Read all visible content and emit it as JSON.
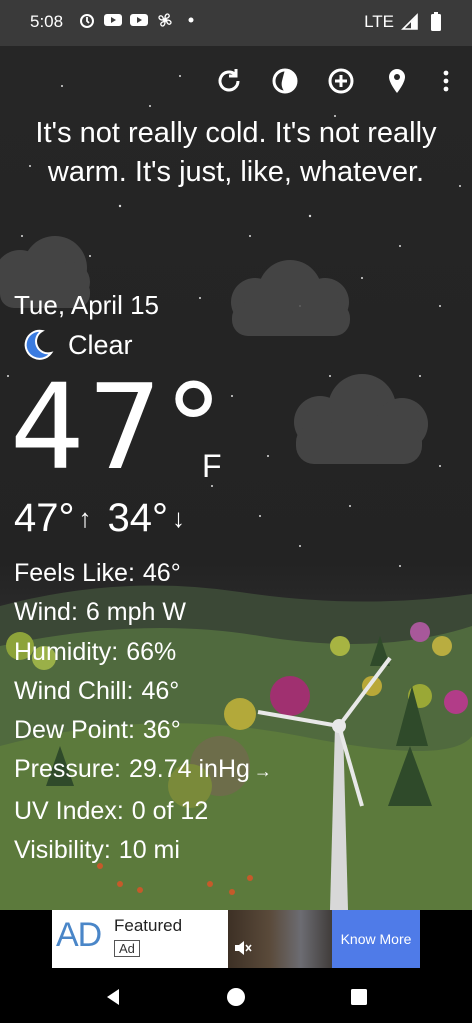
{
  "status_bar": {
    "time": "5:08",
    "network": "LTE",
    "icons": [
      "alarm-icon",
      "youtube-icon",
      "youtube-icon",
      "fan-icon",
      "dot-icon",
      "signal-icon",
      "battery-icon"
    ]
  },
  "toolbar": {
    "buttons": [
      "refresh-icon",
      "radar-icon",
      "add-location-icon",
      "location-pin-icon",
      "more-vert-icon"
    ]
  },
  "tagline": "It's not really cold. It's not really warm. It's just, like, whatever.",
  "weather": {
    "date": "Tue, April 15",
    "condition": "Clear",
    "condition_icon": "moon-icon",
    "temperature": "47°",
    "unit": "F",
    "high": "47°",
    "low": "34°"
  },
  "details": [
    {
      "label": "Feels Like:",
      "value": "46°"
    },
    {
      "label": "Wind:",
      "value": "6 mph W"
    },
    {
      "label": "Humidity:",
      "value": "66%"
    },
    {
      "label": "Wind Chill:",
      "value": "46°"
    },
    {
      "label": "Dew Point:",
      "value": "36°"
    },
    {
      "label": "Pressure:",
      "value": "29.74 inHg"
    },
    {
      "label": "UV Index:",
      "value": "0 of 12"
    },
    {
      "label": "Visibility:",
      "value": "10 mi"
    }
  ],
  "pressure_trend": "→",
  "ad": {
    "logo": "AD",
    "featured": "Featured",
    "tag": "Ad",
    "cta": "Know More"
  },
  "colors": {
    "accent_moon": "#3a7be0",
    "ad_cta": "#4f7be8"
  }
}
